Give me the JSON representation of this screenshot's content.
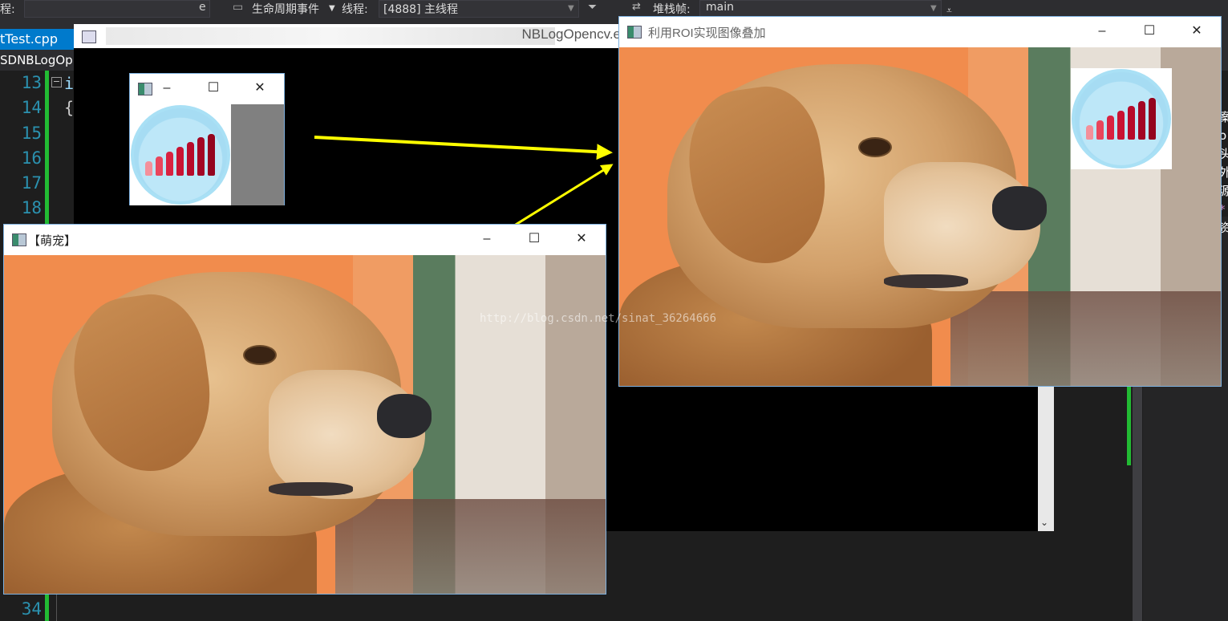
{
  "ide": {
    "process_label": "程:",
    "process_tail": "e",
    "lifecycle_label": "生命周期事件",
    "thread_label": "线程:",
    "thread_value": "[4888] 主线程",
    "stackframe_label": "堆栈帧:",
    "stackframe_value": "main",
    "file_tab": "tTest.cpp",
    "nav_text": "SDNBLogOp",
    "line_numbers": [
      "13",
      "14",
      "15",
      "16",
      "17",
      "18",
      "34"
    ],
    "code_fragments": [
      "i",
      "{"
    ],
    "right_chars": [
      "案",
      "o",
      "头",
      "外",
      "源",
      "*",
      "资"
    ]
  },
  "console": {
    "title": "NBLogOpencv.e"
  },
  "windows": {
    "logo_window": {
      "title": ""
    },
    "pet_window": {
      "title": "【萌宠】"
    },
    "roi_window": {
      "title": "利用ROI实现图像叠加"
    }
  },
  "watermark": "http://blog.csdn.net/sinat_36264666",
  "colors": {
    "arrow": "#ffff00",
    "ide_accent": "#007acc",
    "change_bar": "#22bb33"
  },
  "icons": [
    "window-app-icon",
    "minimize-icon",
    "maximize-icon",
    "close-icon",
    "signal-bars-icon",
    "dropdown-arrow-icon"
  ]
}
